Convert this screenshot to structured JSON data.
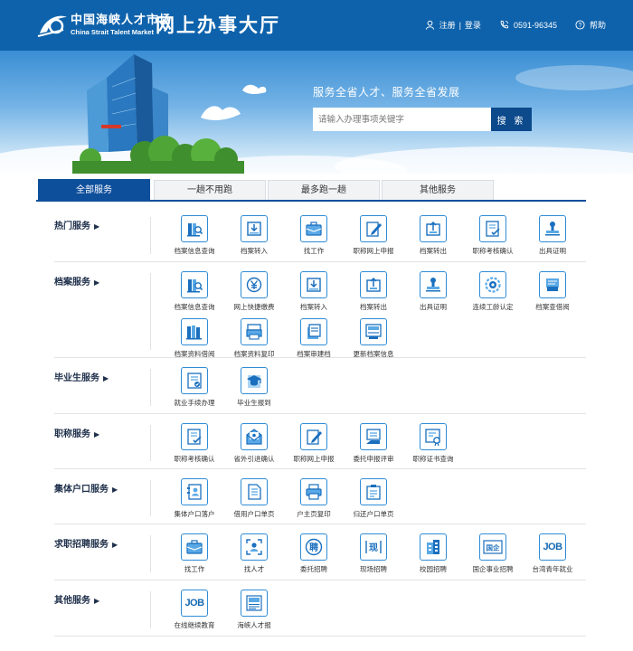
{
  "header": {
    "logo_cn": "中国海峡人才市场",
    "logo_en": "China Strait Talent Market",
    "title": "网上办事大厅",
    "register": "注册",
    "login": "登录",
    "divider": "|",
    "phone": "0591-96345",
    "help": "帮助"
  },
  "banner": {
    "slogan": "服务全省人才、服务全省发展",
    "search_placeholder": "请输入办理事项关键字",
    "search_button": "搜 索"
  },
  "tabs": [
    "全部服务",
    "一趟不用跑",
    "最多跑一趟",
    "其他服务"
  ],
  "active_tab": "全部服务",
  "sections": [
    {
      "title": "热门服务",
      "items": [
        {
          "label": "档案信息查询",
          "icon": "archive-search-icon"
        },
        {
          "label": "档案转入",
          "icon": "archive-in-icon"
        },
        {
          "label": "找工作",
          "icon": "briefcase-icon"
        },
        {
          "label": "职称网上申报",
          "icon": "edit-doc-icon"
        },
        {
          "label": "档案转出",
          "icon": "archive-out-icon"
        },
        {
          "label": "职称考核确认",
          "icon": "check-doc-icon"
        },
        {
          "label": "出具证明",
          "icon": "stamp-icon"
        }
      ]
    },
    {
      "title": "档案服务",
      "items": [
        {
          "label": "档案信息查询",
          "icon": "archive-search-icon"
        },
        {
          "label": "网上快捷缴费",
          "icon": "yen-coin-icon"
        },
        {
          "label": "档案转入",
          "icon": "archive-in-icon"
        },
        {
          "label": "档案转出",
          "icon": "archive-out-icon"
        },
        {
          "label": "出具证明",
          "icon": "stamp-icon"
        },
        {
          "label": "连续工龄认定",
          "icon": "gear-cycle-icon"
        },
        {
          "label": "档案查借阅",
          "icon": "reading-icon"
        },
        {
          "label": "档案资料借阅",
          "icon": "books-icon"
        },
        {
          "label": "档案资料复印",
          "icon": "copier-icon"
        },
        {
          "label": "档案审建档",
          "icon": "file-stack-icon"
        },
        {
          "label": "更新档案信息",
          "icon": "update-file-icon"
        }
      ]
    },
    {
      "title": "毕业生服务",
      "items": [
        {
          "label": "就业手续办理",
          "icon": "checklist-icon"
        },
        {
          "label": "毕业生报到",
          "icon": "graduation-cap-icon"
        }
      ]
    },
    {
      "title": "职称服务",
      "items": [
        {
          "label": "职称考核确认",
          "icon": "check-doc-icon"
        },
        {
          "label": "省外引进确认",
          "icon": "envelope-icon"
        },
        {
          "label": "职称网上申报",
          "icon": "edit-doc-icon"
        },
        {
          "label": "委托申报评审",
          "icon": "hand-doc-icon"
        },
        {
          "label": "职称证书查询",
          "icon": "certificate-icon"
        }
      ]
    },
    {
      "title": "集体户口服务",
      "items": [
        {
          "label": "集体户口落户",
          "icon": "address-book-icon"
        },
        {
          "label": "借用户口单页",
          "icon": "document-icon"
        },
        {
          "label": "户主页复印",
          "icon": "printer-icon"
        },
        {
          "label": "归还户口单页",
          "icon": "clipboard-icon"
        }
      ]
    },
    {
      "title": "求职招聘服务",
      "items": [
        {
          "label": "找工作",
          "icon": "briefcase-icon"
        },
        {
          "label": "找人才",
          "icon": "person-scan-icon"
        },
        {
          "label": "委托招聘",
          "icon": "hire-badge-icon"
        },
        {
          "label": "现场招聘",
          "icon": "onsite-icon"
        },
        {
          "label": "校园招聘",
          "icon": "building-icon"
        },
        {
          "label": "国企事业招聘",
          "icon": "state-enterprise-icon"
        },
        {
          "label": "台湾青年就业",
          "icon": "job-badge-icon"
        }
      ]
    },
    {
      "title": "其他服务",
      "items": [
        {
          "label": "在线继续教育",
          "icon": "job-badge-icon"
        },
        {
          "label": "海峡人才报",
          "icon": "newspaper-icon"
        }
      ]
    }
  ],
  "badges": {
    "hire": "聘",
    "onsite": "现",
    "state": "国企",
    "job": "JOB"
  },
  "colors": {
    "header_bg": "#0e62ab",
    "accent": "#0e4f9c",
    "icon_stroke": "#2e8cd6"
  }
}
